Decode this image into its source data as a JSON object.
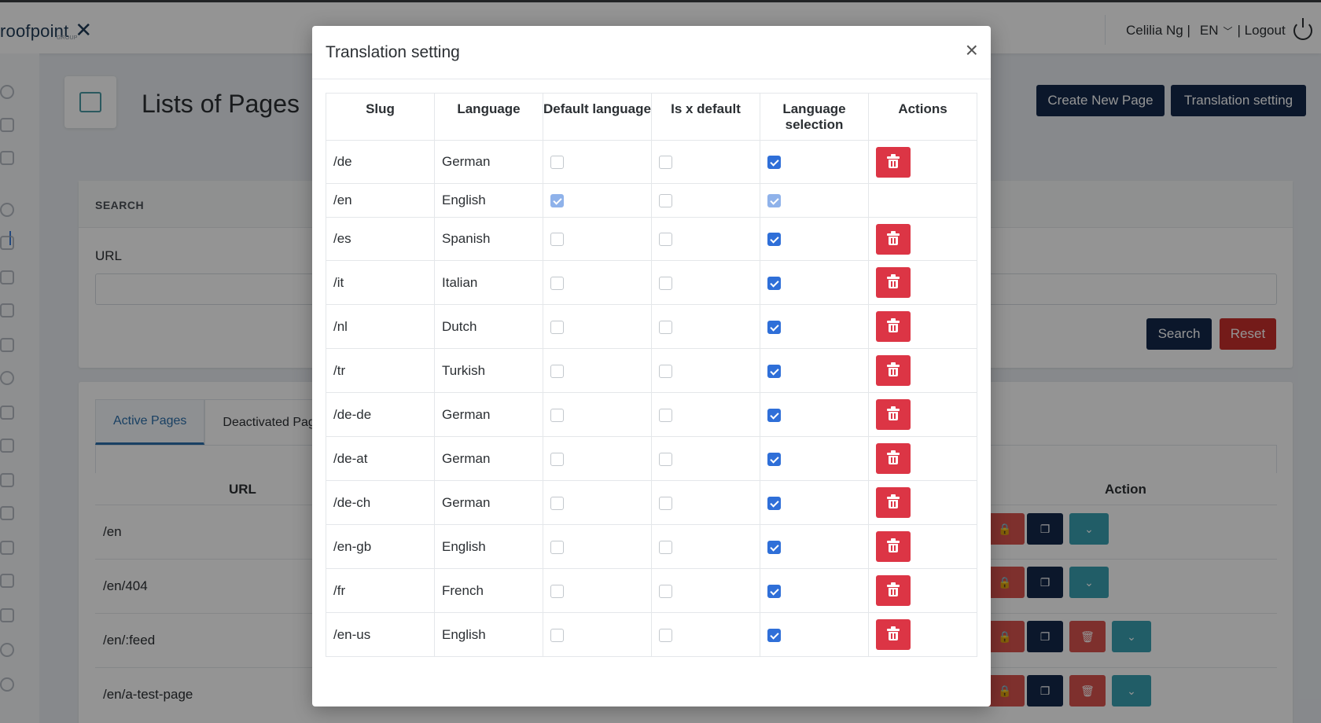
{
  "header": {
    "logo_text": "roofpoint",
    "logo_group": "GROUP",
    "user_text": "Celilia Ng |",
    "language": "EN",
    "logout_text": "| Logout"
  },
  "page": {
    "title": "Lists of Pages",
    "create_button": "Create New Page",
    "translation_button": "Translation setting",
    "search": {
      "section_label": "SEARCH",
      "url_label": "URL",
      "search_button": "Search",
      "reset_button": "Reset"
    },
    "tabs": [
      "Active Pages",
      "Deactivated Page"
    ],
    "columns": {
      "url": "URL",
      "action": "Action"
    },
    "rows": [
      "/en",
      "/en/404",
      "/en/:feed",
      "/en/a-test-page"
    ]
  },
  "modal": {
    "title": "Translation setting",
    "close": "×",
    "columns": [
      "Slug",
      "Language",
      "Default language",
      "Is x default",
      "Language selection",
      "Actions"
    ],
    "rows": [
      {
        "slug": "/de",
        "language": "German",
        "default": false,
        "x_default": false,
        "selection": true,
        "deletable": true
      },
      {
        "slug": "/en",
        "language": "English",
        "default": true,
        "x_default": false,
        "selection": true,
        "deletable": false
      },
      {
        "slug": "/es",
        "language": "Spanish",
        "default": false,
        "x_default": false,
        "selection": true,
        "deletable": true
      },
      {
        "slug": "/it",
        "language": "Italian",
        "default": false,
        "x_default": false,
        "selection": true,
        "deletable": true
      },
      {
        "slug": "/nl",
        "language": "Dutch",
        "default": false,
        "x_default": false,
        "selection": true,
        "deletable": true
      },
      {
        "slug": "/tr",
        "language": "Turkish",
        "default": false,
        "x_default": false,
        "selection": true,
        "deletable": true
      },
      {
        "slug": "/de-de",
        "language": "German",
        "default": false,
        "x_default": false,
        "selection": true,
        "deletable": true
      },
      {
        "slug": "/de-at",
        "language": "German",
        "default": false,
        "x_default": false,
        "selection": true,
        "deletable": true
      },
      {
        "slug": "/de-ch",
        "language": "German",
        "default": false,
        "x_default": false,
        "selection": true,
        "deletable": true
      },
      {
        "slug": "/en-gb",
        "language": "English",
        "default": false,
        "x_default": false,
        "selection": true,
        "deletable": true
      },
      {
        "slug": "/fr",
        "language": "French",
        "default": false,
        "x_default": false,
        "selection": true,
        "deletable": true
      },
      {
        "slug": "/en-us",
        "language": "English",
        "default": false,
        "x_default": false,
        "selection": true,
        "deletable": true
      }
    ]
  },
  "colors": {
    "navy": "#13294b",
    "danger": "#dc3545",
    "accent": "#2f6fd8",
    "teal": "#3aa1b1"
  },
  "icons": [
    "close-icon",
    "trash-icon",
    "lock-icon",
    "copy-icon",
    "chevron-down-icon",
    "power-icon",
    "pages-icon"
  ]
}
